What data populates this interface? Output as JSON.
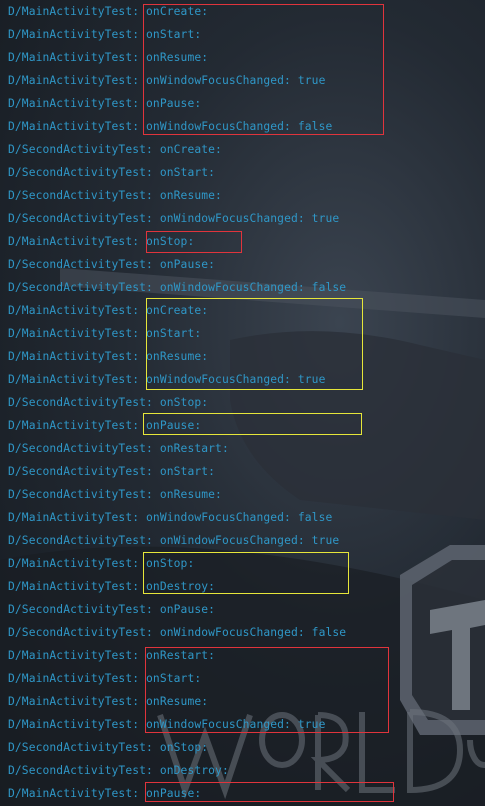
{
  "log_lines": [
    {
      "tag": "D/MainActivityTest:",
      "msg": "onCreate:"
    },
    {
      "tag": "D/MainActivityTest:",
      "msg": "onStart:"
    },
    {
      "tag": "D/MainActivityTest:",
      "msg": "onResume:"
    },
    {
      "tag": "D/MainActivityTest:",
      "msg": "onWindowFocusChanged: true"
    },
    {
      "tag": "D/MainActivityTest:",
      "msg": "onPause:"
    },
    {
      "tag": "D/MainActivityTest:",
      "msg": "onWindowFocusChanged: false"
    },
    {
      "tag": "D/SecondActivityTest:",
      "msg": "onCreate:"
    },
    {
      "tag": "D/SecondActivityTest:",
      "msg": "onStart:"
    },
    {
      "tag": "D/SecondActivityTest:",
      "msg": "onResume:"
    },
    {
      "tag": "D/SecondActivityTest:",
      "msg": "onWindowFocusChanged: true"
    },
    {
      "tag": "D/MainActivityTest:",
      "msg": "onStop:"
    },
    {
      "tag": "D/SecondActivityTest:",
      "msg": "onPause:"
    },
    {
      "tag": "D/SecondActivityTest:",
      "msg": "onWindowFocusChanged: false"
    },
    {
      "tag": "D/MainActivityTest:",
      "msg": "onCreate:"
    },
    {
      "tag": "D/MainActivityTest:",
      "msg": "onStart:"
    },
    {
      "tag": "D/MainActivityTest:",
      "msg": "onResume:"
    },
    {
      "tag": "D/MainActivityTest:",
      "msg": "onWindowFocusChanged: true"
    },
    {
      "tag": "D/SecondActivityTest:",
      "msg": "onStop:"
    },
    {
      "tag": "D/MainActivityTest:",
      "msg": "onPause:"
    },
    {
      "tag": "D/SecondActivityTest:",
      "msg": "onRestart:"
    },
    {
      "tag": "D/SecondActivityTest:",
      "msg": "onStart:"
    },
    {
      "tag": "D/SecondActivityTest:",
      "msg": "onResume:"
    },
    {
      "tag": "D/MainActivityTest:",
      "msg": "onWindowFocusChanged: false"
    },
    {
      "tag": "D/SecondActivityTest:",
      "msg": "onWindowFocusChanged: true"
    },
    {
      "tag": "D/MainActivityTest:",
      "msg": "onStop:"
    },
    {
      "tag": "D/MainActivityTest:",
      "msg": "onDestroy:"
    },
    {
      "tag": "D/SecondActivityTest:",
      "msg": "onPause:"
    },
    {
      "tag": "D/SecondActivityTest:",
      "msg": "onWindowFocusChanged: false"
    },
    {
      "tag": "D/MainActivityTest:",
      "msg": "onRestart:"
    },
    {
      "tag": "D/MainActivityTest:",
      "msg": "onStart:"
    },
    {
      "tag": "D/MainActivityTest:",
      "msg": "onResume:"
    },
    {
      "tag": "D/MainActivityTest:",
      "msg": "onWindowFocusChanged: true"
    },
    {
      "tag": "D/SecondActivityTest:",
      "msg": "onStop:"
    },
    {
      "tag": "D/SecondActivityTest:",
      "msg": "onDestroy:"
    },
    {
      "tag": "D/MainActivityTest:",
      "msg": "onPause:"
    }
  ],
  "colors": {
    "log_text": "#2f97c7",
    "highlight_red": "#e0343c",
    "highlight_yellow": "#e6e63a"
  }
}
